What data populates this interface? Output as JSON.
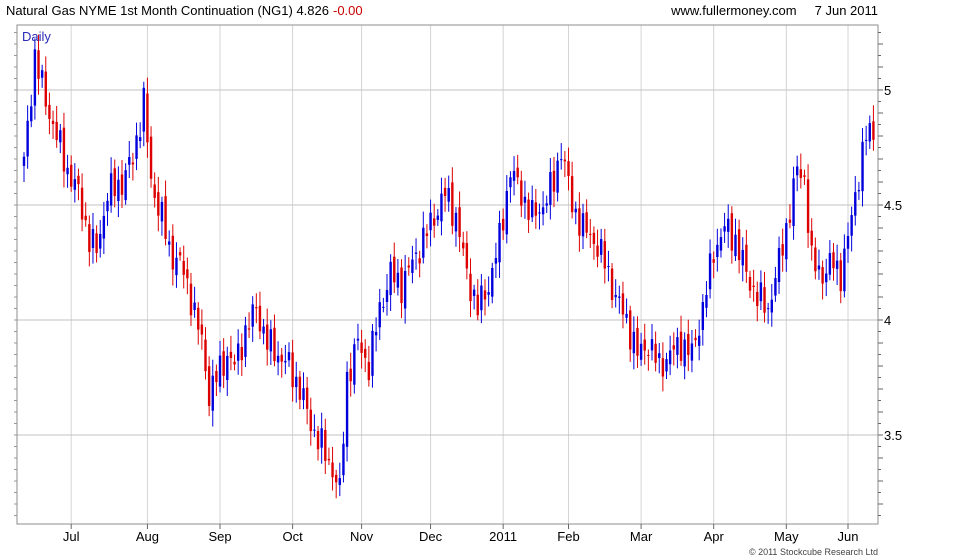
{
  "header": {
    "title": "Natural Gas NYME 1st Month Continuation (NG1) 4.826",
    "change": "-0.00",
    "site": "www.fullermoney.com",
    "date": "7 Jun 2011"
  },
  "footer": {
    "copyright": "© 2011 Stockcube Research Ltd"
  },
  "chart_data": {
    "type": "candlestick",
    "period_label": "Daily",
    "x_tick_labels": [
      "Jul",
      "Aug",
      "Sep",
      "Oct",
      "Nov",
      "Dec",
      "2011",
      "Feb",
      "Mar",
      "Apr",
      "May",
      "Jun"
    ],
    "x_tick_index": [
      13,
      34,
      54,
      74,
      93,
      112,
      132,
      150,
      170,
      190,
      210,
      227
    ],
    "y_tick_labels": [
      "5",
      "4.5",
      "4",
      "3.5"
    ],
    "y_ticks": [
      5.0,
      4.5,
      4.0,
      3.5
    ],
    "ylim": [
      3.1,
      5.3
    ],
    "grid": true,
    "colors": {
      "up": "#0000dd",
      "down": "#dd0000",
      "grid": "#d4d4d4"
    },
    "anchors": [
      [
        0,
        4.68
      ],
      [
        3,
        5.15
      ],
      [
        6,
        4.95
      ],
      [
        9,
        4.8
      ],
      [
        12,
        4.65
      ],
      [
        15,
        4.55
      ],
      [
        18,
        4.35
      ],
      [
        20,
        4.3
      ],
      [
        23,
        4.55
      ],
      [
        27,
        4.6
      ],
      [
        30,
        4.7
      ],
      [
        33,
        4.95
      ],
      [
        35,
        4.6
      ],
      [
        38,
        4.45
      ],
      [
        40,
        4.3
      ],
      [
        43,
        4.25
      ],
      [
        46,
        4.1
      ],
      [
        49,
        3.9
      ],
      [
        51,
        3.68
      ],
      [
        53,
        3.75
      ],
      [
        56,
        3.85
      ],
      [
        58,
        3.8
      ],
      [
        61,
        3.95
      ],
      [
        64,
        4.05
      ],
      [
        67,
        3.9
      ],
      [
        70,
        3.85
      ],
      [
        73,
        3.8
      ],
      [
        76,
        3.7
      ],
      [
        79,
        3.55
      ],
      [
        82,
        3.45
      ],
      [
        85,
        3.35
      ],
      [
        87,
        3.25
      ],
      [
        89,
        3.75
      ],
      [
        92,
        3.9
      ],
      [
        95,
        3.8
      ],
      [
        98,
        4.05
      ],
      [
        101,
        4.2
      ],
      [
        104,
        4.15
      ],
      [
        107,
        4.25
      ],
      [
        110,
        4.35
      ],
      [
        113,
        4.45
      ],
      [
        116,
        4.55
      ],
      [
        119,
        4.45
      ],
      [
        122,
        4.2
      ],
      [
        125,
        4.05
      ],
      [
        128,
        4.15
      ],
      [
        131,
        4.35
      ],
      [
        134,
        4.65
      ],
      [
        137,
        4.55
      ],
      [
        140,
        4.45
      ],
      [
        143,
        4.5
      ],
      [
        146,
        4.6
      ],
      [
        148,
        4.75
      ],
      [
        151,
        4.5
      ],
      [
        154,
        4.4
      ],
      [
        157,
        4.35
      ],
      [
        160,
        4.25
      ],
      [
        163,
        4.1
      ],
      [
        166,
        4.0
      ],
      [
        169,
        3.85
      ],
      [
        172,
        3.9
      ],
      [
        175,
        3.8
      ],
      [
        178,
        3.85
      ],
      [
        181,
        3.9
      ],
      [
        184,
        3.85
      ],
      [
        187,
        4.05
      ],
      [
        190,
        4.3
      ],
      [
        193,
        4.4
      ],
      [
        196,
        4.35
      ],
      [
        199,
        4.2
      ],
      [
        202,
        4.1
      ],
      [
        205,
        4.05
      ],
      [
        208,
        4.25
      ],
      [
        210,
        4.4
      ],
      [
        213,
        4.65
      ],
      [
        215,
        4.62
      ],
      [
        217,
        4.25
      ],
      [
        220,
        4.2
      ],
      [
        223,
        4.25
      ],
      [
        225,
        4.2
      ],
      [
        227,
        4.35
      ],
      [
        229,
        4.55
      ],
      [
        232,
        4.8
      ],
      [
        234,
        4.826
      ]
    ]
  }
}
